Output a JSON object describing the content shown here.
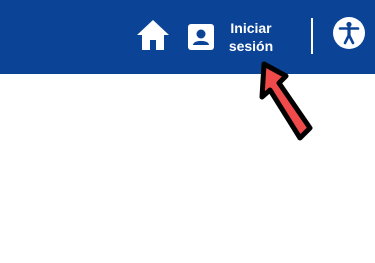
{
  "header": {
    "background": "#0b4396",
    "home_icon": "home-icon",
    "login_icon": "user-account-icon",
    "login_line1": "Iniciar",
    "login_line2": "sesión",
    "accessibility_icon": "accessibility-icon"
  },
  "annotation": {
    "arrow_color": "#f04a4a",
    "arrow_target": "login-button"
  }
}
